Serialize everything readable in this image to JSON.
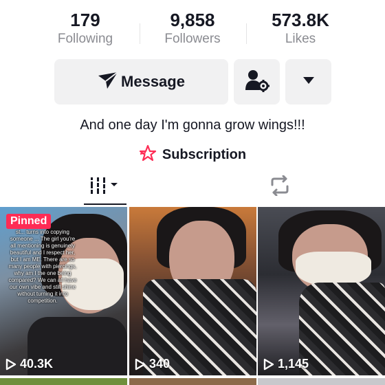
{
  "stats": [
    {
      "value": "179",
      "label": "Following"
    },
    {
      "value": "9,858",
      "label": "Followers"
    },
    {
      "value": "573.8K",
      "label": "Likes"
    }
  ],
  "actions": {
    "message_label": "Message",
    "add_friend_icon": "add-friend-settings-icon",
    "more_icon": "caret-down-icon"
  },
  "bio": "And one day I'm gonna grow wings!!!",
  "subscription": {
    "label": "Subscription",
    "icon": "star-icon",
    "icon_color": "#fe2c55"
  },
  "tabs": [
    {
      "name": "videos",
      "icon": "grid-bars-icon",
      "active": true
    },
    {
      "name": "reposts",
      "icon": "repost-icon",
      "active": false
    }
  ],
  "videos": [
    {
      "pinned_label": "Pinned",
      "overlay_text": "st... turns into copying someone ... The girl you're all mentioning is genuinely beautiful and I respect her, but I am ME. There are so many people with piercings, why am I the one being compared? We can all have our own vibe and still shine without turning it into competition.",
      "views": "40.3K"
    },
    {
      "views": "340"
    },
    {
      "views": "1,145"
    }
  ],
  "colors": {
    "accent": "#fe2c55",
    "text": "#161823",
    "secondary_text": "#8a8b91",
    "button_bg": "#f1f1f2"
  }
}
